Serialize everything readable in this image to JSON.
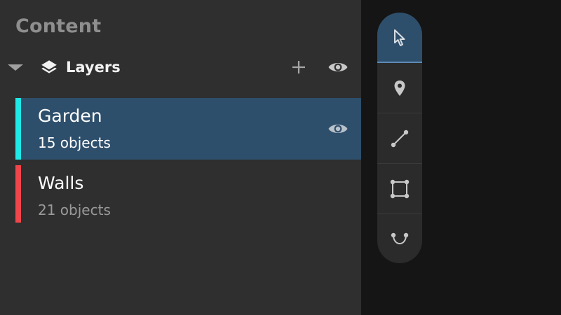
{
  "panel": {
    "title": "Content",
    "layers_header": {
      "label": "Layers",
      "add_icon": "plus-icon",
      "visibility_icon": "eye-icon"
    },
    "layers": [
      {
        "name": "Garden",
        "count_text": "15 objects",
        "color": "#1ee8e8",
        "selected": true
      },
      {
        "name": "Walls",
        "count_text": "21 objects",
        "color": "#f0454a",
        "selected": false
      }
    ]
  },
  "toolbar": {
    "tools": [
      {
        "icon": "cursor-arrow-icon",
        "active": true
      },
      {
        "icon": "map-pin-icon",
        "active": false
      },
      {
        "icon": "line-tool-icon",
        "active": false
      },
      {
        "icon": "polygon-rectangle-icon",
        "active": false
      },
      {
        "icon": "curve-tool-icon",
        "active": false
      }
    ]
  },
  "colors": {
    "panel_bg": "#2f2f2f",
    "selection": "#2e4f6c",
    "garden": "#1ee8e8",
    "walls": "#f0454a"
  }
}
